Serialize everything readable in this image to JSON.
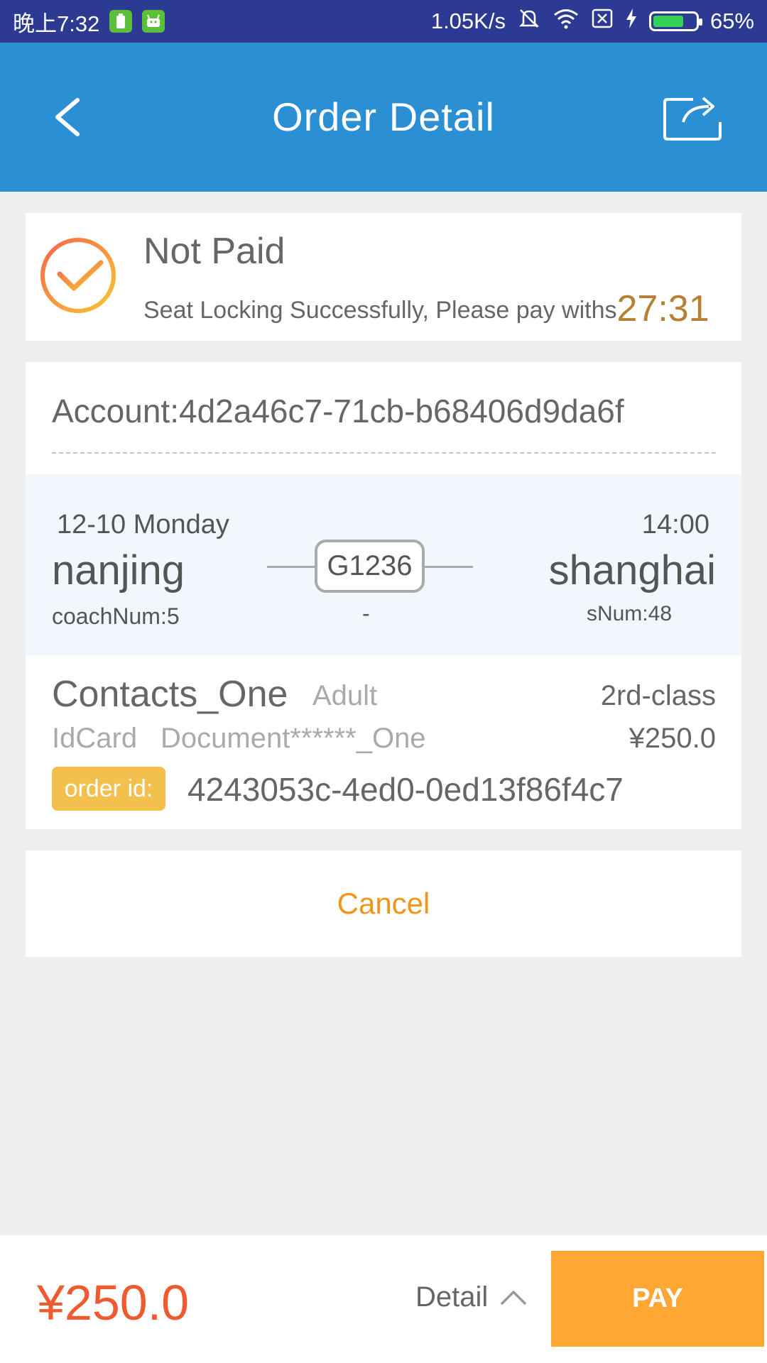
{
  "status_bar": {
    "time": "晚上7:32",
    "network_speed": "1.05K/s",
    "battery": "65%",
    "battery_level": 0.65,
    "icons": [
      "battery-app-icon",
      "android-app-icon",
      "mute-icon",
      "wifi-icon",
      "no-sim-icon",
      "charging-icon",
      "battery-icon"
    ]
  },
  "header": {
    "title": "Order Detail",
    "back_icon": "back-arrow-icon",
    "share_icon": "share-icon"
  },
  "order_status": {
    "title": "Not Paid",
    "message": "Seat Locking Successfully, Please pay withs",
    "countdown": "27:31",
    "icon": "check-circle-icon"
  },
  "ticket": {
    "account": "Account:4d2a46c7-71cb-b68406d9da6f",
    "date": "12-10 Monday",
    "time": "14:00",
    "from": "nanjing",
    "to": "shanghai",
    "coach": "coachNum:5",
    "seat_num": "sNum:48",
    "train_number": "G1236",
    "train_sub": "-"
  },
  "passenger": {
    "name": "Contacts_One",
    "type": "Adult",
    "seat_class": "2rd-class",
    "id_type": "IdCard",
    "document": "Document******_One",
    "price": "¥250.0",
    "order_label": "order id:",
    "order_id": "4243053c-4ed0-0ed13f86f4c7"
  },
  "actions": {
    "cancel_label": "Cancel"
  },
  "footer": {
    "total": "¥250.0",
    "detail_label": "Detail",
    "pay_label": "PAY"
  },
  "colors": {
    "status_bar": "#2c3a93",
    "header": "#2b8fd3",
    "countdown": "#b68032",
    "order_badge": "#f3c04e",
    "cancel_text": "#f39516",
    "total_price": "#f05a2f",
    "pay_button": "#ffa733"
  }
}
